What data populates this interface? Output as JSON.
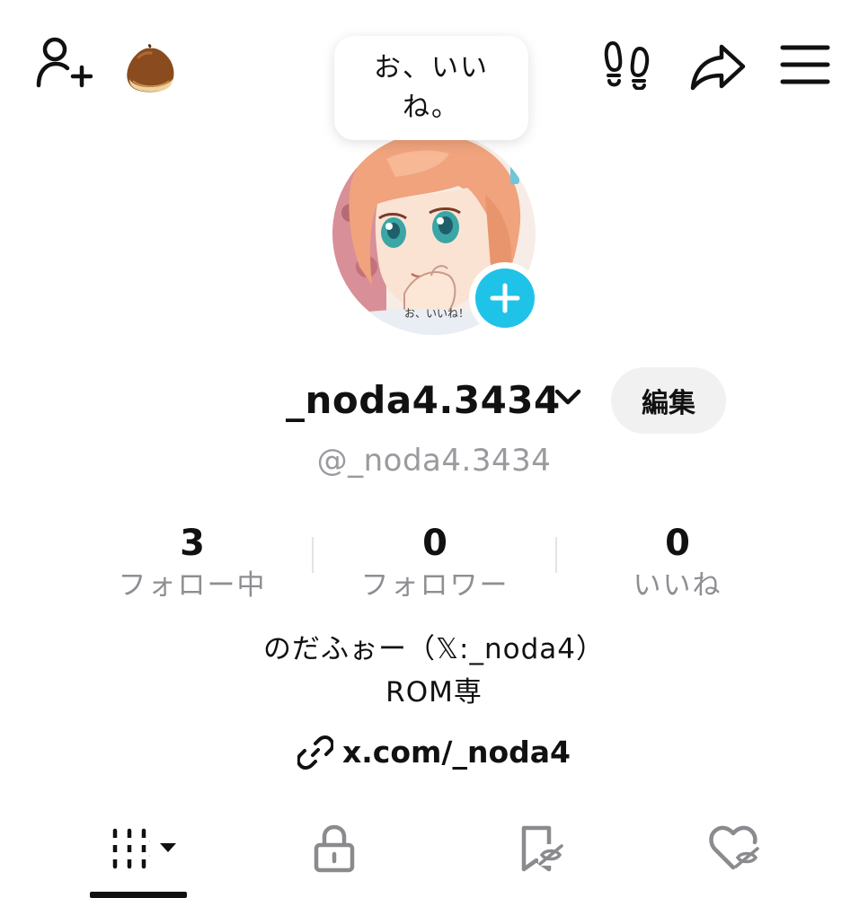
{
  "header": {
    "add_friend_icon": "person-plus-icon",
    "chestnut_icon": "chestnut-emoji",
    "footprints_icon": "footprints-icon",
    "share_icon": "share-arrow-icon",
    "menu_icon": "hamburger-menu-icon"
  },
  "bubble": {
    "text": "お、いいね。"
  },
  "profile": {
    "display_name": "_noda4.3434",
    "username": "@_noda4.3434",
    "edit_label": "編集",
    "avatar_watermark": "お、いいね！",
    "add_badge_color": "#20c3e8"
  },
  "stats": [
    {
      "value": "3",
      "label": "フォロー中"
    },
    {
      "value": "0",
      "label": "フォロワー"
    },
    {
      "value": "0",
      "label": "いいね"
    }
  ],
  "bio": {
    "line1": "のだふぉー（𝕏:_noda4）",
    "line2": "ROM専",
    "link": "x.com/_noda4"
  },
  "tabs": [
    {
      "icon": "grid-videos-icon",
      "active": true
    },
    {
      "icon": "lock-icon",
      "active": false
    },
    {
      "icon": "bookmark-hidden-icon",
      "active": false
    },
    {
      "icon": "heart-hidden-icon",
      "active": false
    }
  ]
}
